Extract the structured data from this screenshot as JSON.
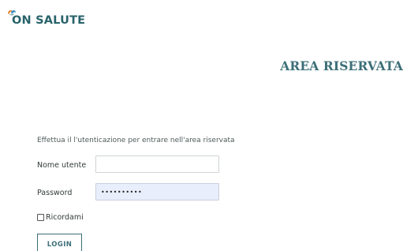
{
  "brand": {
    "logo_text": "ON SALUTE",
    "logo_icon": "brand-mark-icon",
    "colors": {
      "teal": "#28636a",
      "orange": "#e8892f",
      "blue": "#3a8ec2"
    }
  },
  "header": {
    "title": "AREA RISERVATA"
  },
  "login_form": {
    "intro": "Effettua il l'utenticazione per entrare nell'area riservata",
    "username_label": "Nome utente",
    "username_value": "",
    "password_label": "Password",
    "password_value": "••••••••••",
    "remember_label": "Ricordami",
    "remember_checked": false,
    "submit_label": "LOGIN"
  },
  "colors": {
    "accent": "#3d6f78",
    "autofill_bg": "#e8eefb"
  }
}
